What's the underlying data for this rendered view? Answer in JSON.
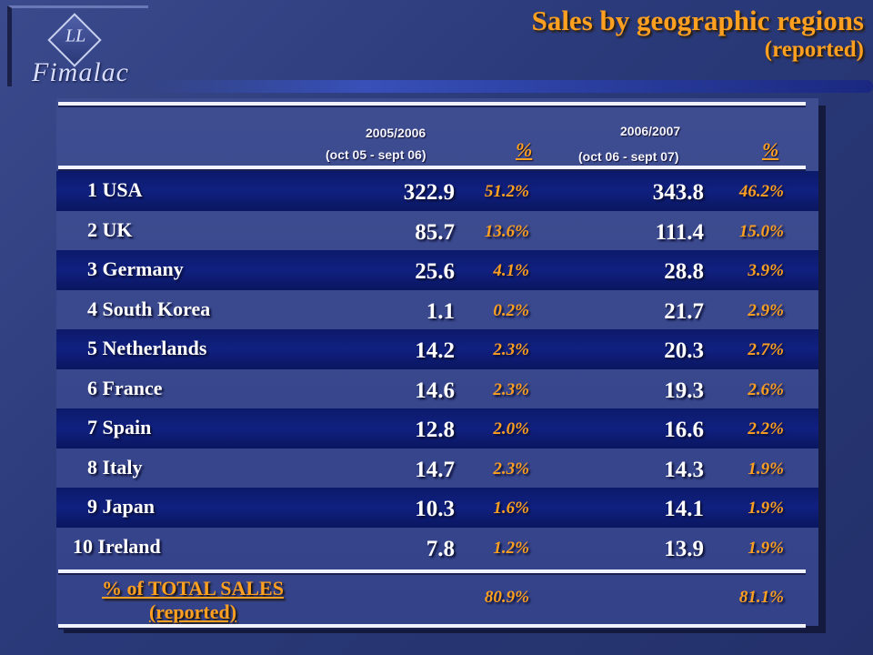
{
  "brand": {
    "logo_monogram": "LL",
    "name": "Fimalac"
  },
  "title": {
    "line1": "Sales by geographic regions",
    "line2": "(reported)"
  },
  "columns": {
    "period1": "2005/2006",
    "period1_range": "(oct 05  - sept 06)",
    "pct1": "%",
    "period2": "2006/2007",
    "period2_range": "(oct 06  - sept 07)",
    "pct2": "%"
  },
  "rows": [
    {
      "name": "1  USA",
      "v1": "322.9",
      "p1": "51.2%",
      "v2": "343.8",
      "p2": "46.2%"
    },
    {
      "name": "2  UK",
      "v1": "85.7",
      "p1": "13.6%",
      "v2": "111.4",
      "p2": "15.0%"
    },
    {
      "name": "3  Germany",
      "v1": "25.6",
      "p1": "4.1%",
      "v2": "28.8",
      "p2": "3.9%"
    },
    {
      "name": "4  South Korea",
      "v1": "1.1",
      "p1": "0.2%",
      "v2": "21.7",
      "p2": "2.9%"
    },
    {
      "name": "5  Netherlands",
      "v1": "14.2",
      "p1": "2.3%",
      "v2": "20.3",
      "p2": "2.7%"
    },
    {
      "name": "6  France",
      "v1": "14.6",
      "p1": "2.3%",
      "v2": "19.3",
      "p2": "2.6%"
    },
    {
      "name": "7 Spain",
      "v1": "12.8",
      "p1": "2.0%",
      "v2": "16.6",
      "p2": "2.2%"
    },
    {
      "name": "8  Italy",
      "v1": "14.7",
      "p1": "2.3%",
      "v2": "14.3",
      "p2": "1.9%"
    },
    {
      "name": "9 Japan",
      "v1": "10.3",
      "p1": "1.6%",
      "v2": "14.1",
      "p2": "1.9%"
    },
    {
      "name": "10 Ireland",
      "v1": "7.8",
      "p1": "1.2%",
      "v2": "13.9",
      "p2": "1.9%"
    }
  ],
  "total": {
    "label1": "% of TOTAL SALES",
    "label2": "(reported)",
    "p1": "80.9%",
    "p2": "81.1%"
  },
  "colors": {
    "accent": "#ffa020",
    "band": "#102080",
    "background": "#2a3a7a"
  }
}
